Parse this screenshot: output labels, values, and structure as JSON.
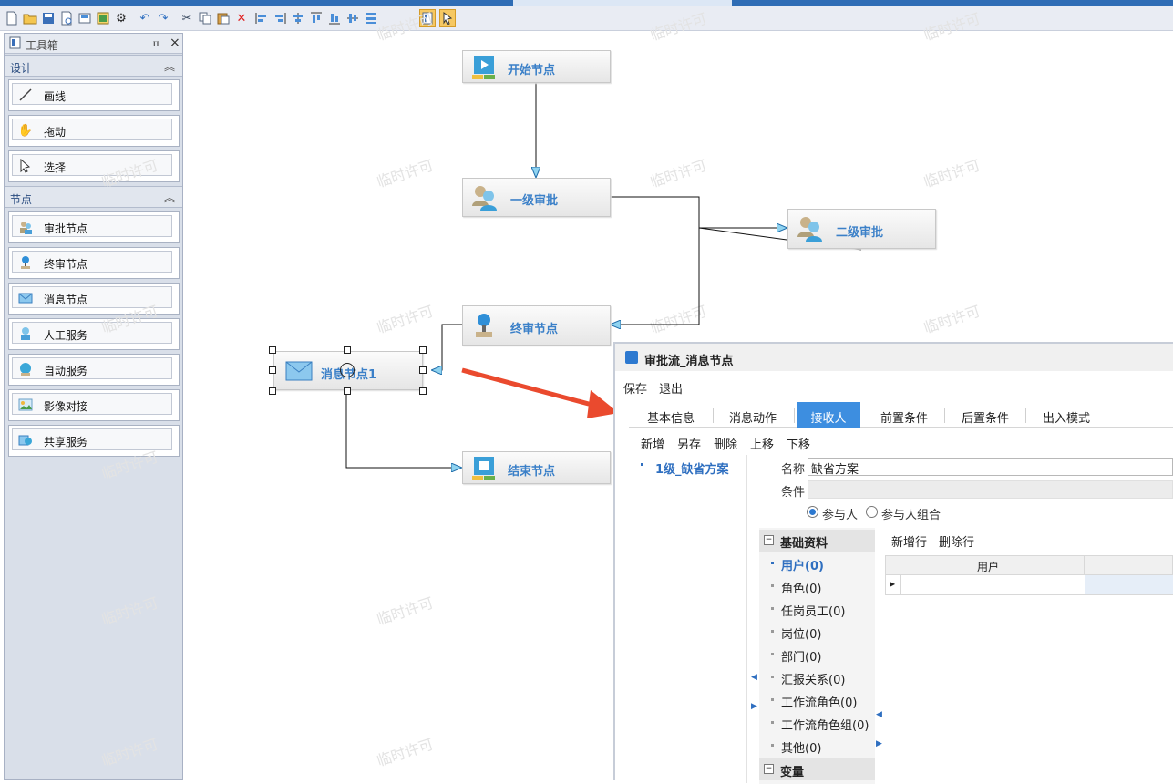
{
  "toolbar": {
    "icons": [
      "new-icon",
      "open-icon",
      "save-icon",
      "print-preview-icon",
      "properties-icon",
      "export-icon",
      "settings-gear-icon",
      "undo-icon",
      "redo-icon",
      "cut-icon",
      "copy-icon",
      "paste-icon",
      "delete-icon",
      "align-left-icon",
      "align-right-icon",
      "align-center-icon",
      "align-top-icon",
      "align-bottom-icon",
      "align-middle-icon",
      "distribute-icon",
      "toolbox-toggle-icon",
      "pointer-mode-icon"
    ]
  },
  "toolbox": {
    "title": "工具箱",
    "pin_glyph": "ⲡ",
    "close_glyph": "×",
    "sections": {
      "design": {
        "label": "设计",
        "items": [
          {
            "label": "画线",
            "icon": "draw-line-icon"
          },
          {
            "label": "拖动",
            "icon": "drag-hand-icon"
          },
          {
            "label": "选择",
            "icon": "select-cursor-icon"
          }
        ]
      },
      "nodes": {
        "label": "节点",
        "items": [
          {
            "label": "审批节点",
            "icon": "approval-node-icon"
          },
          {
            "label": "终审节点",
            "icon": "final-review-node-icon"
          },
          {
            "label": "消息节点",
            "icon": "message-node-icon"
          },
          {
            "label": "人工服务",
            "icon": "manual-service-icon"
          },
          {
            "label": "自动服务",
            "icon": "auto-service-icon"
          },
          {
            "label": "影像对接",
            "icon": "image-interface-icon"
          },
          {
            "label": "共享服务",
            "icon": "shared-service-icon"
          }
        ]
      }
    }
  },
  "canvas": {
    "watermark": "临时许可",
    "nodes": {
      "start": "开始节点",
      "level1": "一级审批",
      "level2": "二级审批",
      "final": "终审节点",
      "message": "消息节点1",
      "end": "结束节点"
    }
  },
  "dialog": {
    "title": "审批流_消息节点",
    "menu": {
      "save": "保存",
      "exit": "退出"
    },
    "tabs": [
      "基本信息",
      "消息动作",
      "接收人",
      "前置条件",
      "后置条件",
      "出入模式"
    ],
    "active_tab": "接收人",
    "actions": [
      "新增",
      "另存",
      "删除",
      "上移",
      "下移"
    ],
    "schemes": [
      "1级_缺省方案"
    ],
    "form": {
      "name_label": "名称",
      "name_value": "缺省方案",
      "condition_label": "条件",
      "condition_value": "",
      "radio_participant": "参与人",
      "radio_group": "参与人组合",
      "radio_selected": "参与人"
    },
    "tree": {
      "basic_category": "基础资料",
      "items": [
        "用户(0)",
        "角色(0)",
        "任岗员工(0)",
        "岗位(0)",
        "部门(0)",
        "汇报关系(0)",
        "工作流角色(0)",
        "工作流角色组(0)",
        "其他(0)"
      ],
      "selected": "用户(0)",
      "var_category": "变量"
    },
    "grid": {
      "add_row": "新增行",
      "delete_row": "删除行",
      "column": "用户"
    }
  },
  "colors": {
    "accent": "#3d8ee0",
    "node_label": "#3b80c8",
    "annotation_arrow": "#e8402a"
  }
}
